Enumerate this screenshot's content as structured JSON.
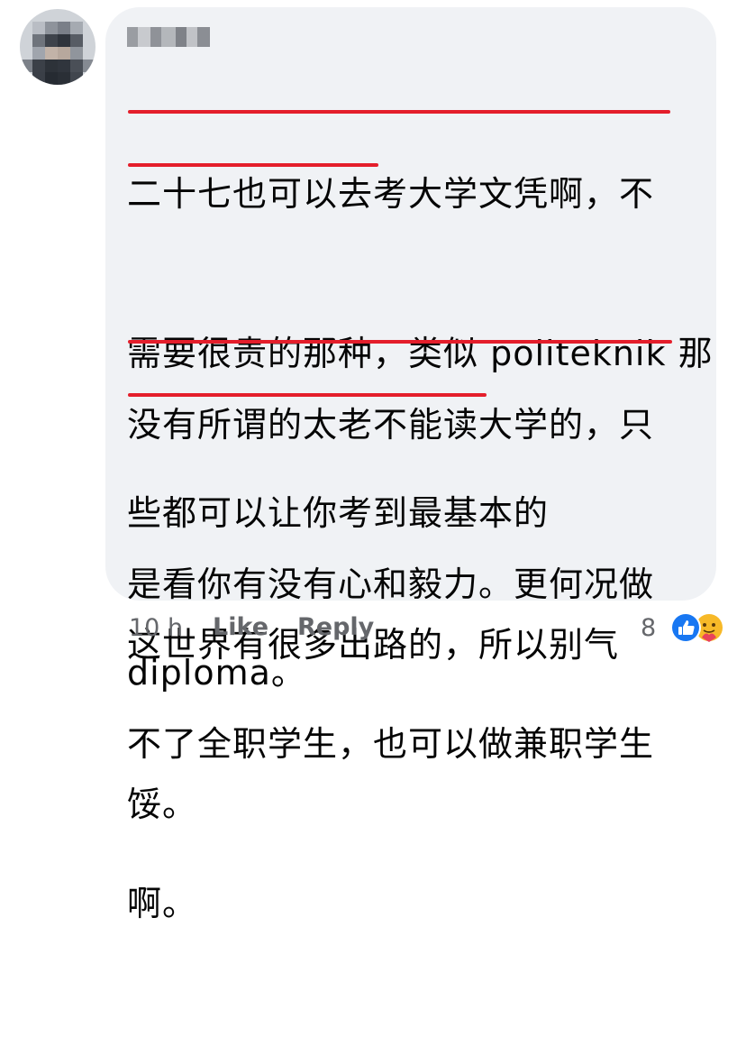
{
  "comment": {
    "author_name_redacted": "",
    "paragraphs": [
      [
        "二十七也可以去考大学文凭啊，不",
        "需要很贵的那种，类似 politeknik 那",
        "些都可以让你考到最基本的",
        "diploma。"
      ],
      [
        "没有所谓的太老不能读大学的，只",
        "是看你有没有心和毅力。更何况做",
        "不了全职学生，也可以做兼职学生",
        "啊。"
      ],
      [
        "这世界有很多出路的，所以别气",
        "馁。"
      ]
    ]
  },
  "footer": {
    "time": "10 h",
    "like_label": "Like",
    "reply_label": "Reply",
    "reaction_count": "8"
  },
  "reactions": [
    "like-icon",
    "care-icon"
  ],
  "colors": {
    "bubble_bg": "#f0f2f5",
    "underline": "#e41e2b",
    "like_blue": "#1877f2",
    "care_yellow": "#f7b928"
  }
}
